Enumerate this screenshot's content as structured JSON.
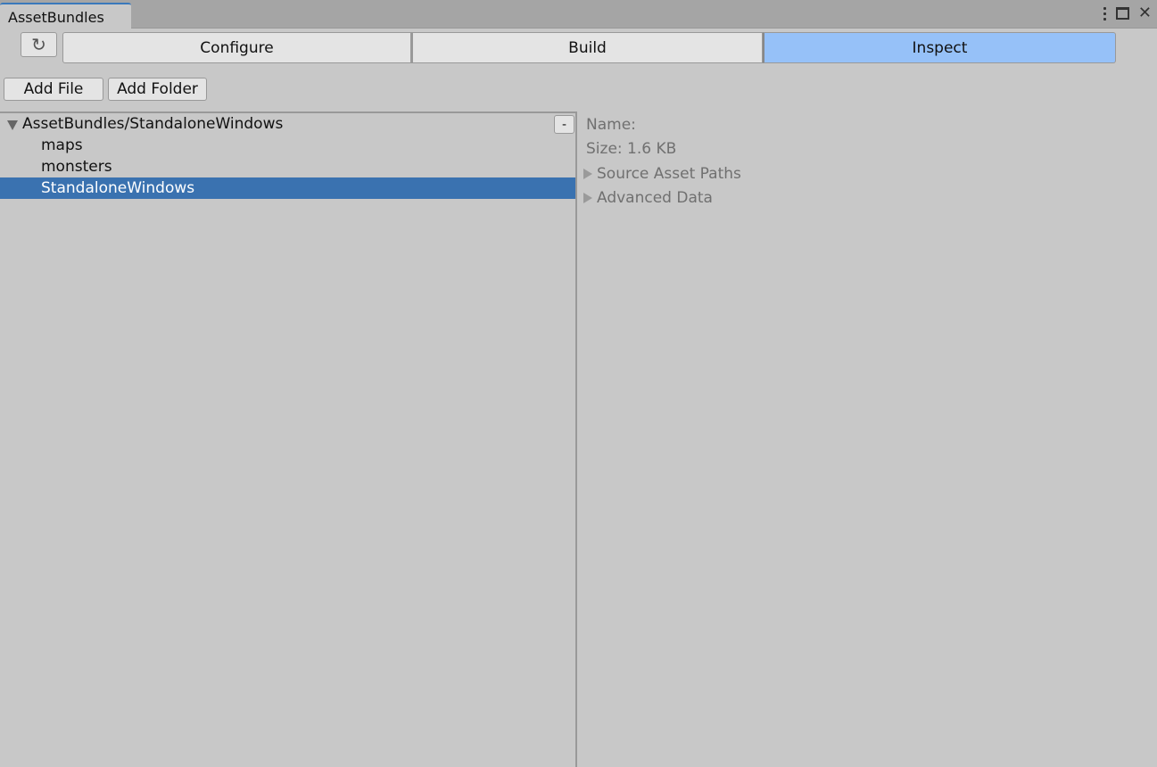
{
  "window": {
    "tab_title": "AssetBundles",
    "icons": [
      "more-options-icon",
      "maximize-icon",
      "close-icon"
    ],
    "close_glyph": "✕"
  },
  "toolbar": {
    "refresh_icon": "refresh-icon",
    "refresh_glyph": "↻",
    "modes": [
      {
        "label": "Configure",
        "selected": false
      },
      {
        "label": "Build",
        "selected": false
      },
      {
        "label": "Inspect",
        "selected": true
      }
    ],
    "selected_color": "#96c1f8"
  },
  "actions": {
    "add_file": "Add File",
    "add_folder": "Add Folder"
  },
  "tree": {
    "root": {
      "label": "AssetBundles/StandaloneWindows",
      "expanded": true,
      "remove_label": "-"
    },
    "children": [
      {
        "label": "maps",
        "selected": false
      },
      {
        "label": "monsters",
        "selected": false
      },
      {
        "label": "StandaloneWindows",
        "selected": true
      }
    ],
    "selection_color": "#3a72b0"
  },
  "inspector": {
    "name_label": "Name:",
    "size_label": "Size: 1.6 KB",
    "sections": [
      {
        "label": "Source Asset Paths",
        "expanded": false
      },
      {
        "label": "Advanced Data",
        "expanded": false
      }
    ]
  }
}
